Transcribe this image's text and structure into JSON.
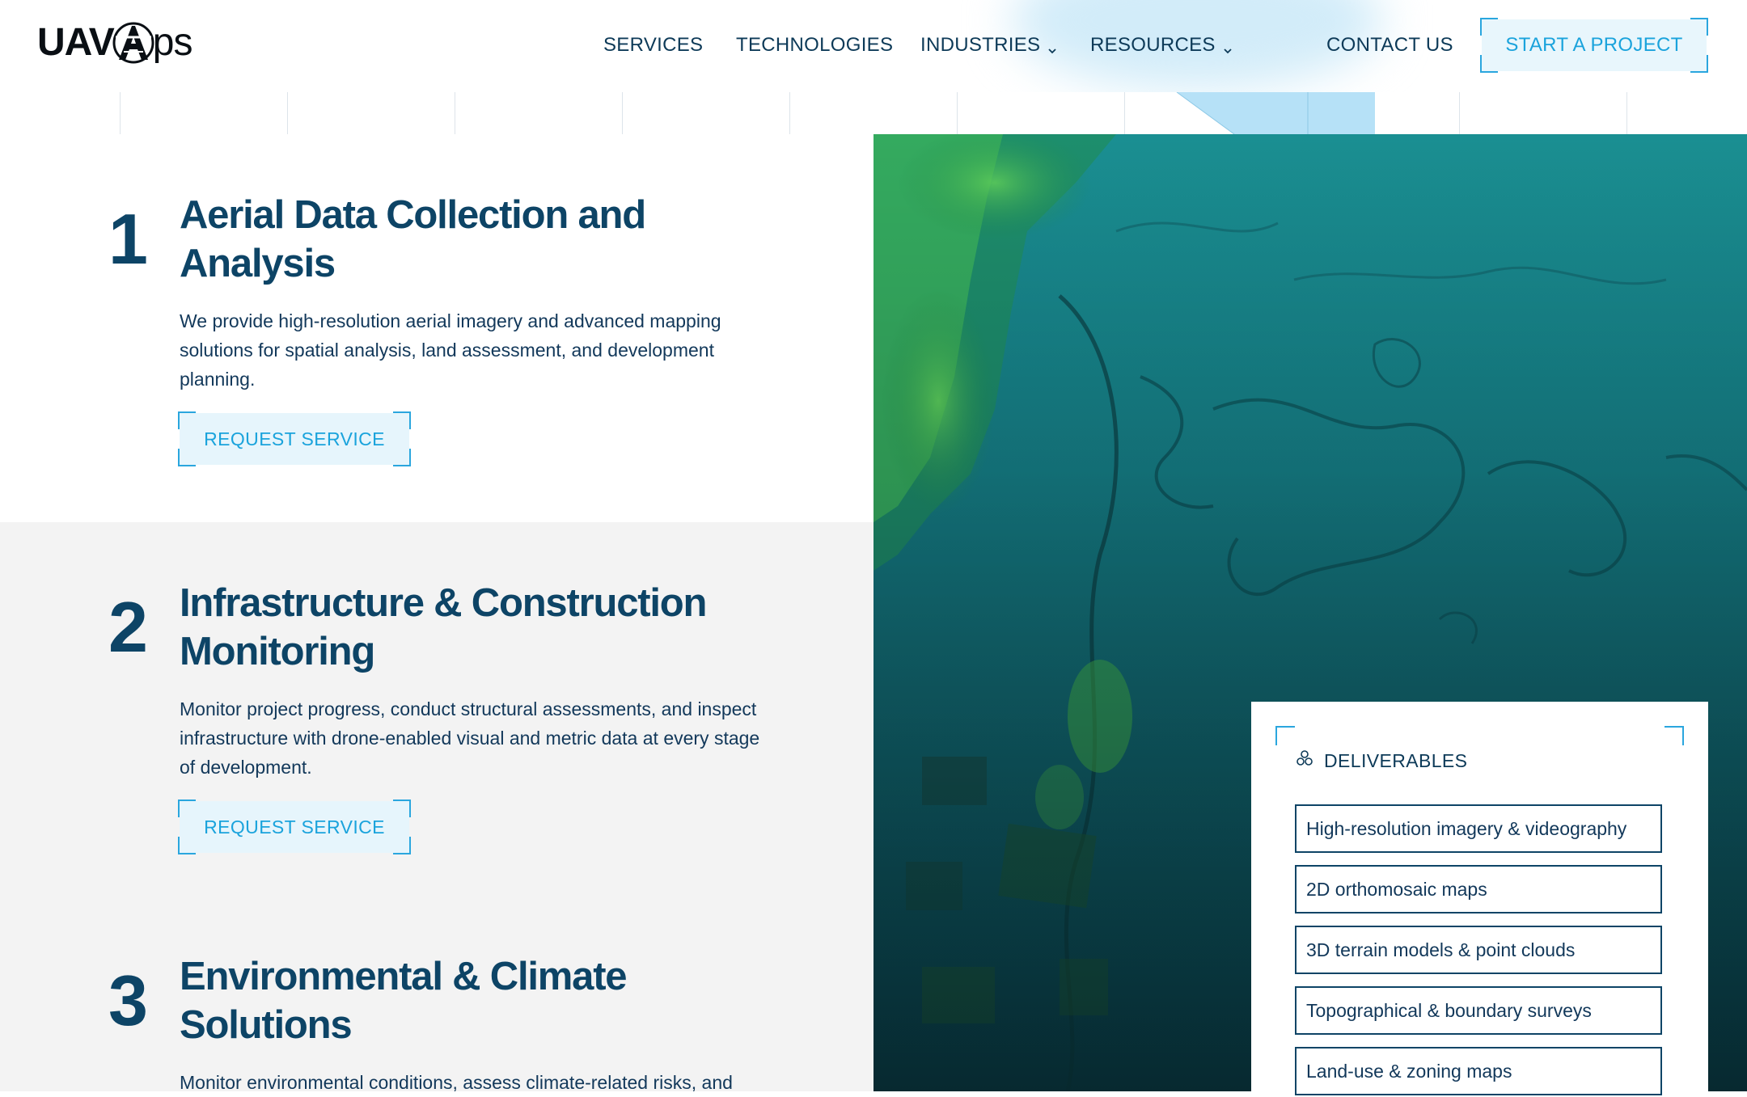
{
  "header": {
    "logo_text_left": "UAV",
    "logo_text_right": "ps",
    "nav": [
      {
        "label": "SERVICES"
      },
      {
        "label": "TECHNOLOGIES"
      },
      {
        "label": "INDUSTRIES",
        "has_dropdown": true
      },
      {
        "label": "RESOURCES",
        "has_dropdown": true
      },
      {
        "label": "CONTACT US"
      }
    ],
    "cta_label": "START A PROJECT"
  },
  "services": [
    {
      "number": "1",
      "title_line1": "Aerial Data Collection and",
      "title_line2": "Analysis",
      "description": "We provide high-resolution aerial imagery and advanced mapping solutions for spatial analysis, land assessment, and development planning.",
      "button_label": "REQUEST SERVICE"
    },
    {
      "number": "2",
      "title_line1": "Infrastructure & Construction",
      "title_line2": "Monitoring",
      "description": "Monitor project progress, conduct structural assessments, and inspect infrastructure with drone-enabled visual and metric data at every stage of development.",
      "button_label": "REQUEST SERVICE"
    },
    {
      "number": "3",
      "title_line1": "Environmental & Climate",
      "title_line2": "Solutions",
      "description": "Monitor environmental conditions, assess climate-related risks, and"
    }
  ],
  "deliverables": {
    "heading": "DELIVERABLES",
    "items": [
      "High-resolution imagery & videography",
      "2D orthomosaic maps",
      "3D terrain models & point clouds",
      "Topographical & boundary surveys",
      "Land-use & zoning maps"
    ]
  },
  "colors": {
    "brand_navy": "#0d4466",
    "accent_blue": "#1aa3dc",
    "button_bg": "#e6f5fc",
    "section_grey": "#f3f3f3"
  },
  "icons": {
    "logo": "uavaps-logo",
    "dropdown": "chevron-down-icon",
    "deliverables": "deliverables-icon"
  }
}
